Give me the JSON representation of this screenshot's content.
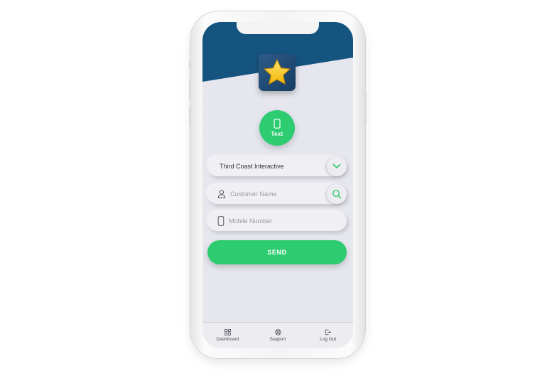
{
  "colors": {
    "brand_navy": "#165480",
    "accent_green": "#2ecc71",
    "screen_bg": "#e6e6ee"
  },
  "app_logo": {
    "icon": "star-icon"
  },
  "mode_button": {
    "label": "Text",
    "icon": "phone-icon"
  },
  "company_select": {
    "value": "Third Coast Interactive",
    "icon": "chevron-down-icon"
  },
  "customer_field": {
    "placeholder": "Customer Name",
    "lead_icon": "user-icon",
    "action_icon": "search-icon"
  },
  "mobile_field": {
    "placeholder": "Mobile Number",
    "lead_icon": "phone-icon"
  },
  "send_button": {
    "label": "SEND"
  },
  "tabbar": {
    "items": [
      {
        "label": "Dashboard",
        "icon": "grid-icon"
      },
      {
        "label": "Support",
        "icon": "lifebuoy-icon"
      },
      {
        "label": "Log Out",
        "icon": "logout-icon"
      }
    ]
  }
}
